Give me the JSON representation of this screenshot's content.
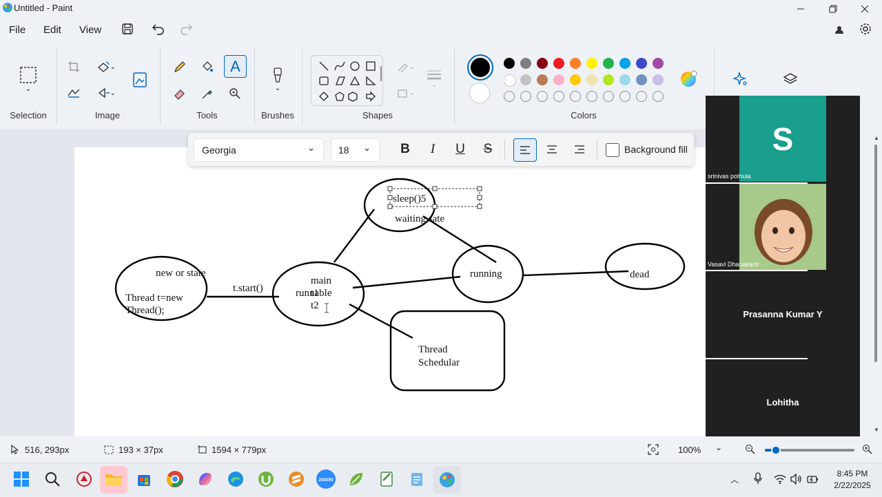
{
  "window": {
    "title": "Untitled - Paint"
  },
  "menu": {
    "file": "File",
    "edit": "Edit",
    "view": "View"
  },
  "ribbon": {
    "selection": "Selection",
    "image": "Image",
    "tools": "Tools",
    "brushes": "Brushes",
    "shapes": "Shapes",
    "colors": "Colors"
  },
  "palette": {
    "primary": "#000000",
    "secondary": "#ffffff",
    "row1": [
      "#000000",
      "#7f7f7f",
      "#880015",
      "#ed1c24",
      "#ff7f27",
      "#fff200",
      "#22b14c",
      "#00a2e8",
      "#3f48cc",
      "#a349a4"
    ],
    "row2": [
      "#ffffff",
      "#c3c3c3",
      "#b97a57",
      "#ffaec9",
      "#ffc90e",
      "#efe4b0",
      "#b5e61d",
      "#99d9ea",
      "#7092be",
      "#c8bfe7"
    ]
  },
  "text_toolbar": {
    "font": "Georgia",
    "size": "18",
    "bold": "B",
    "italic": "I",
    "underline": "U",
    "strike": "S",
    "background_fill": "Background fill"
  },
  "diagram": {
    "sleep": "sleep()5",
    "waiting": "waiting sate",
    "new_state": "new or  state",
    "thread_new_1": "Thread t=new",
    "thread_new_2": "Thread();",
    "start": "t.start()",
    "main": "main",
    "runnable": "runnable",
    "t1": "t1",
    "t2": "t2",
    "running": "running",
    "dead": "dead",
    "scheduler_1": "Thread",
    "scheduler_2": "Schedular"
  },
  "participants": [
    {
      "name": "srinivas pothula",
      "initial": "S"
    },
    {
      "name": "Vasavi Dhanakanti"
    },
    {
      "name": "Prasanna Kumar Y"
    },
    {
      "name": "Lohitha"
    }
  ],
  "status": {
    "cursor": "516, 293px",
    "selection": "193 × 37px",
    "canvas_size": "1594 × 779px",
    "zoom": "100%",
    "zoom_fraction": 0.12
  },
  "taskbar": {
    "time": "8:45 PM",
    "date": "2/22/2025",
    "zoom_app": "zoom"
  },
  "colors": {
    "accent": "#0067c0",
    "teal_tile": "#1a9e8e"
  }
}
